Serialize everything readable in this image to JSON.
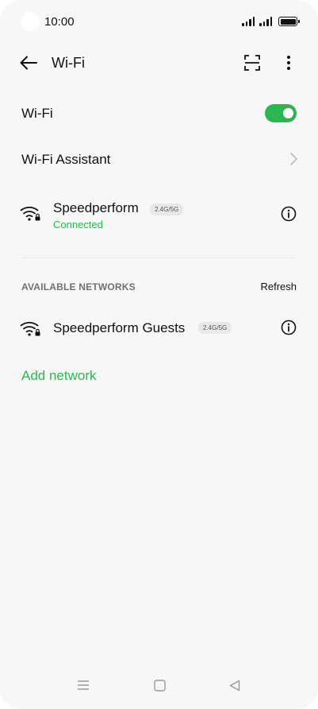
{
  "status_bar": {
    "time": "10:00"
  },
  "header": {
    "title": "Wi-Fi"
  },
  "wifi_toggle": {
    "label": "Wi-Fi",
    "enabled": true
  },
  "assistant": {
    "label": "Wi-Fi Assistant"
  },
  "connected_network": {
    "name": "Speedperform",
    "band": "2.4G/5G",
    "status": "Connected"
  },
  "available": {
    "title": "AVAILABLE NETWORKS",
    "refresh_label": "Refresh",
    "networks": [
      {
        "name": "Speedperform Guests",
        "band": "2.4G/5G"
      }
    ]
  },
  "add_network_label": "Add network",
  "colors": {
    "accent": "#2bb652",
    "background": "#f7f7f7"
  },
  "icons": [
    "back-arrow-icon",
    "scan-icon",
    "more-icon",
    "wifi-lock-icon",
    "info-icon",
    "chevron-right-icon",
    "menu-icon",
    "home-icon",
    "back-icon"
  ]
}
